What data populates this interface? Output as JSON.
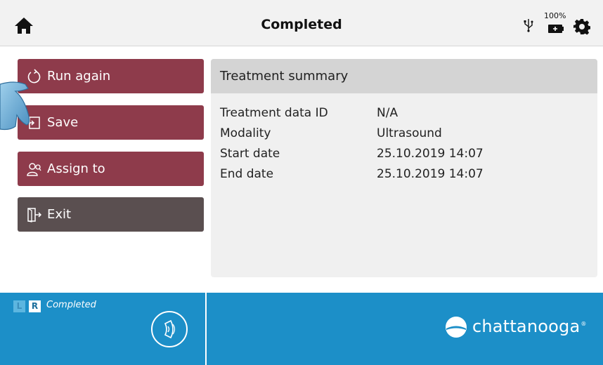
{
  "header": {
    "title": "Completed",
    "home_icon": "home-icon",
    "usb_icon": "usb-icon",
    "battery_percent": "100%",
    "battery_icon": "battery-charging-icon",
    "settings_icon": "gear-icon"
  },
  "actions": [
    {
      "label": "Run again",
      "icon": "refresh-icon"
    },
    {
      "label": "Save",
      "icon": "save-icon"
    },
    {
      "label": "Assign to",
      "icon": "assign-user-icon"
    },
    {
      "label": "Exit",
      "icon": "exit-door-icon"
    }
  ],
  "summary": {
    "title": "Treatment summary",
    "rows": [
      {
        "key": "Treatment data ID",
        "value": "N/A"
      },
      {
        "key": "Modality",
        "value": "Ultrasound"
      },
      {
        "key": "Start date",
        "value": "25.10.2019 14:07"
      },
      {
        "key": "End date",
        "value": "25.10.2019 14:07"
      }
    ]
  },
  "footer": {
    "left_label": "L",
    "right_label": "R",
    "status": "Completed",
    "probe_icon": "ultrasound-probe-icon",
    "brand": "chattanooga",
    "brand_mark": "®"
  },
  "colors": {
    "primary_button": "#8e3b4b",
    "exit_button": "#5a4f50",
    "footer": "#1c8fc8",
    "summary_header": "#d4d4d4"
  }
}
